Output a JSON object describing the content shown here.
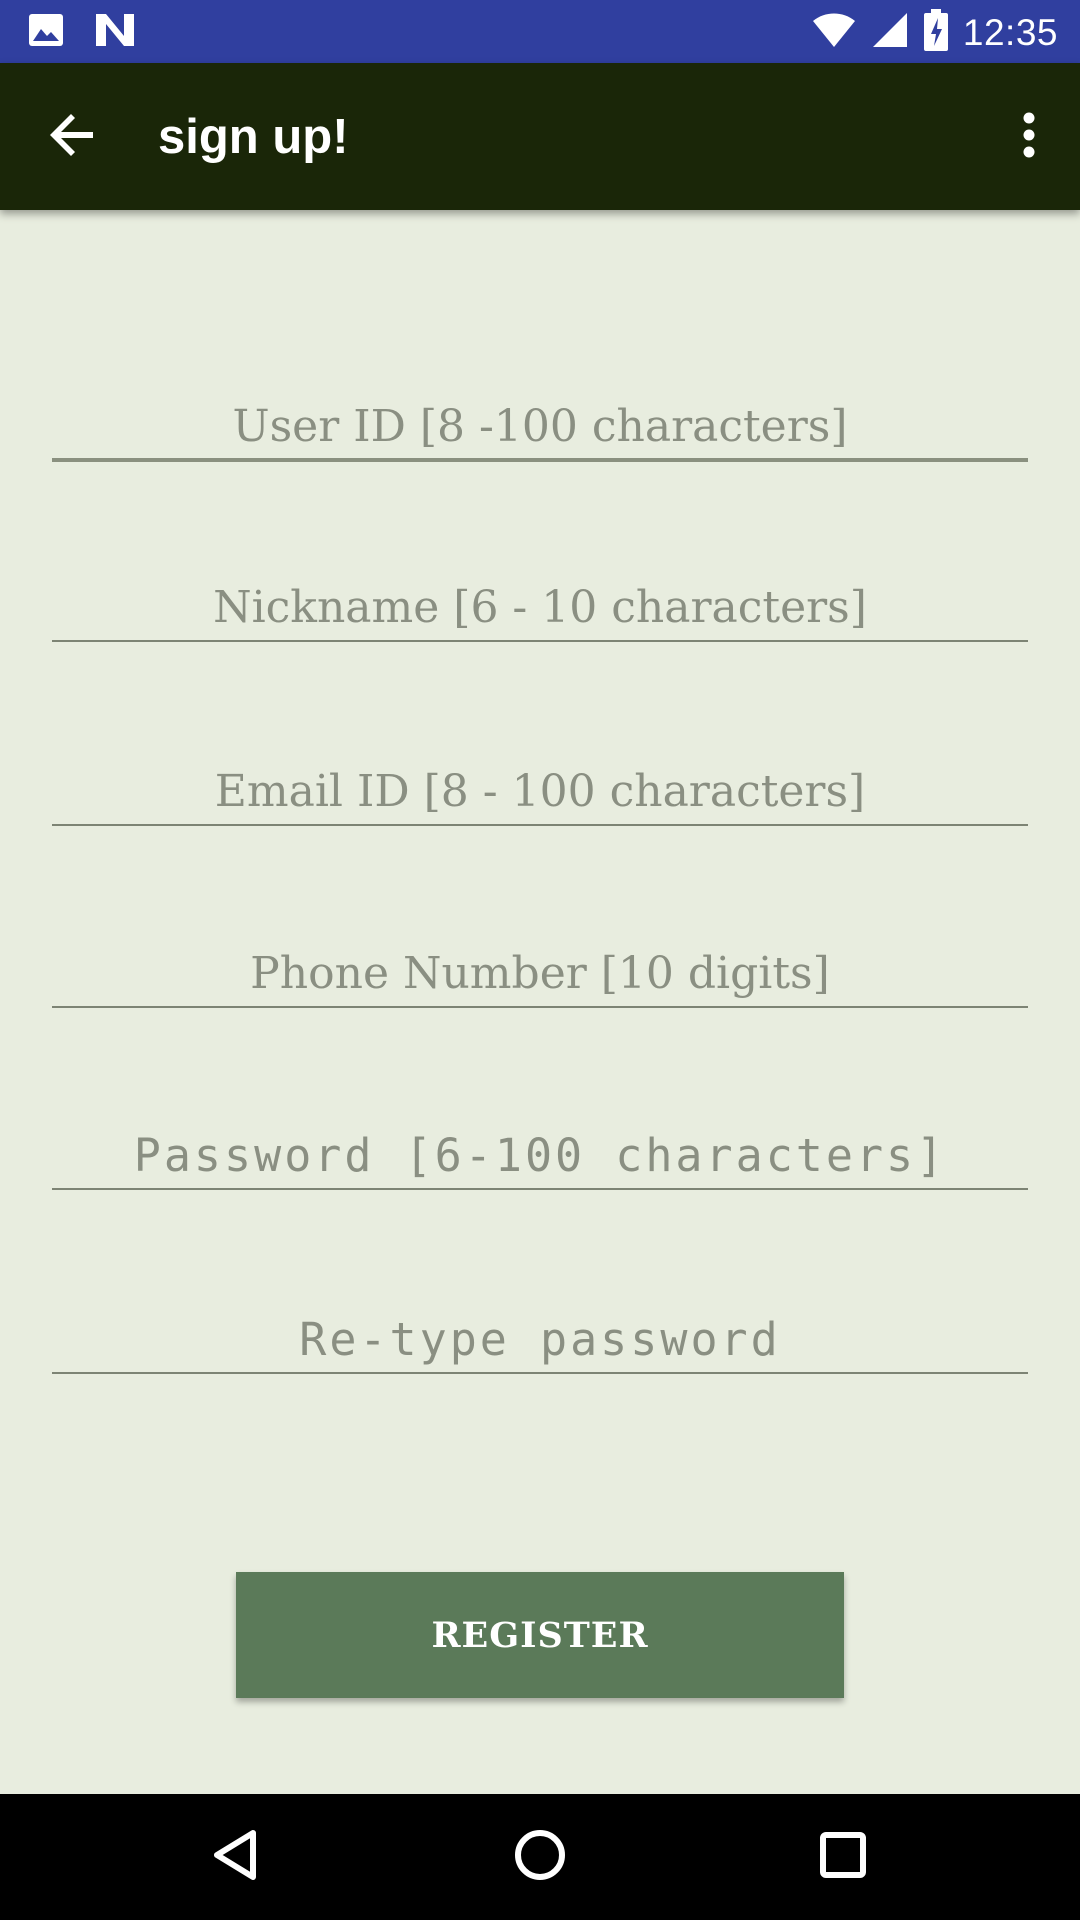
{
  "status_bar": {
    "time": "12:35",
    "left_icons": [
      "image-icon",
      "n-notification-icon"
    ],
    "right_icons": [
      "wifi-icon",
      "cell-signal-icon",
      "battery-charging-icon"
    ]
  },
  "app_bar": {
    "title": "sign up!",
    "back_icon": "arrow-back-icon",
    "menu_icon": "more-vert-icon"
  },
  "form": {
    "user_id": {
      "placeholder": "User ID [8 -100 characters]",
      "value": ""
    },
    "nickname": {
      "placeholder": "Nickname [6 - 10 characters]",
      "value": ""
    },
    "email": {
      "placeholder": "Email ID [8 - 100 characters]",
      "value": ""
    },
    "phone": {
      "placeholder": "Phone Number [10 digits]",
      "value": ""
    },
    "password": {
      "placeholder": "Password [6-100 characters]",
      "value": ""
    },
    "retype_password": {
      "placeholder": "Re-type password",
      "value": ""
    }
  },
  "register_button": {
    "label": "REGISTER"
  },
  "nav_bar": {
    "icons": [
      "back-triangle-icon",
      "home-circle-icon",
      "recents-square-icon"
    ]
  },
  "colors": {
    "status_bar": "#303f9f",
    "app_bar": "#1a2608",
    "background": "#e8eddf",
    "button": "#5b7a59",
    "nav_bar": "#000000"
  }
}
